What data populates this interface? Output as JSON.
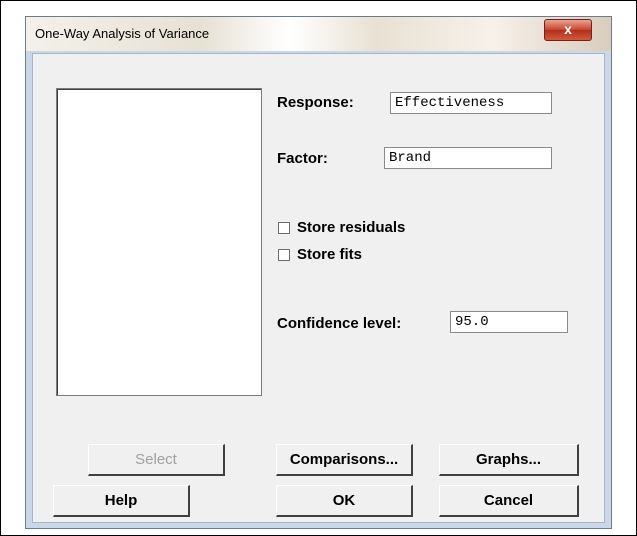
{
  "dialog": {
    "title": "One-Way Analysis of Variance",
    "close_label": "x"
  },
  "fields": {
    "response_label": "Response:",
    "response_value": "Effectiveness",
    "factor_label": "Factor:",
    "factor_value": "Brand",
    "confidence_label": "Confidence level:",
    "confidence_value": "95.0"
  },
  "options": {
    "store_residuals": {
      "label": "Store residuals",
      "checked": false
    },
    "store_fits": {
      "label": "Store fits",
      "checked": false
    }
  },
  "buttons": {
    "select": "Select",
    "comparisons": "Comparisons...",
    "graphs": "Graphs...",
    "help": "Help",
    "ok": "OK",
    "cancel": "Cancel"
  }
}
